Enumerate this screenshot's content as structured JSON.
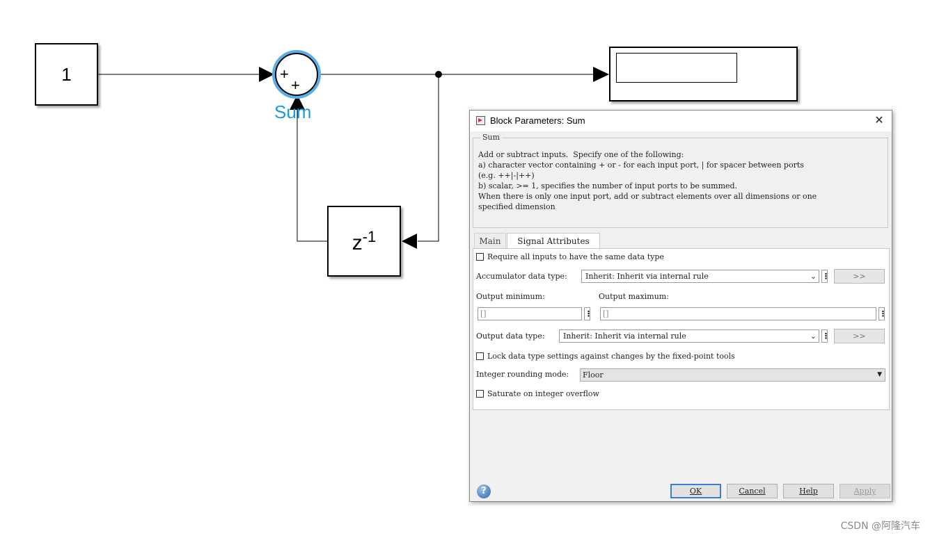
{
  "model": {
    "constant_value": "1",
    "delay_base": "z",
    "delay_exponent": "-1",
    "sum_signs": [
      "+",
      "+"
    ],
    "sum_label": "Sum"
  },
  "dialog": {
    "title": "Block Parameters: Sum",
    "close_label": "✕",
    "group_title": "Sum",
    "description": "Add or subtract inputs.  Specify one of the following:\na) character vector containing + or - for each input port, | for spacer between ports\n(e.g. ++|-|++)\nb) scalar, >= 1, specifies the number of input ports to be summed.\nWhen there is only one input port, add or subtract elements over all dimensions or one\nspecified dimension",
    "tabs": [
      {
        "label": "Main",
        "active": false
      },
      {
        "label": "Signal Attributes",
        "active": true
      }
    ],
    "signal_attributes": {
      "require_same_type_label": "Require all inputs to have the same data type",
      "require_same_type_checked": false,
      "accumulator_label": "Accumulator data type:",
      "accumulator_value": "Inherit: Inherit via internal rule",
      "assistant_button": ">>",
      "output_min_label": "Output minimum:",
      "output_min_value": "[]",
      "output_max_label": "Output maximum:",
      "output_max_value": "[]",
      "output_type_label": "Output data type:",
      "output_type_value": "Inherit: Inherit via internal rule",
      "lock_label": "Lock data type settings against changes by the fixed-point tools",
      "lock_checked": false,
      "rounding_label": "Integer rounding mode:",
      "rounding_value": "Floor",
      "saturate_label": "Saturate on integer overflow",
      "saturate_checked": false
    },
    "buttons": {
      "ok": "OK",
      "cancel": "Cancel",
      "help": "Help",
      "apply": "Apply"
    },
    "help_icon": "?"
  },
  "watermark": "CSDN @阿隆汽车",
  "colors": {
    "accent": "#1a9be0",
    "dialog_bg": "#f0f0f0",
    "ok_border": "#3c7fd1"
  }
}
